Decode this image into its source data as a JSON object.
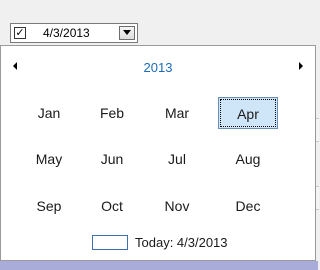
{
  "date_picker": {
    "checked": true,
    "value": "4/3/2013",
    "check_glyph": "✓"
  },
  "calendar": {
    "title": "2013",
    "prev_icon": "triangle-left",
    "next_icon": "triangle-right",
    "months": [
      "Jan",
      "Feb",
      "Mar",
      "Apr",
      "May",
      "Jun",
      "Jul",
      "Aug",
      "Sep",
      "Oct",
      "Nov",
      "Dec"
    ],
    "selected_month": "Apr",
    "today_label": "Today: 4/3/2013"
  },
  "colors": {
    "title": "#1e6bb8",
    "selection_fill": "#cfe6f8",
    "bottom_strip": "#a9acd9"
  }
}
